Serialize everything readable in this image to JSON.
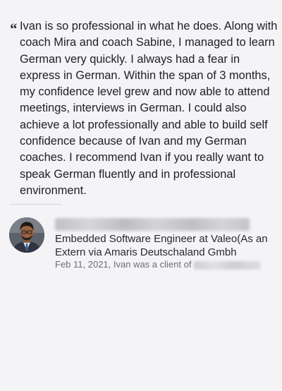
{
  "recommendation": {
    "quote_mark": "“",
    "text": "Ivan is so professional in what he does. Along with coach Mira and coach Sabine, I managed to learn German very quickly. I always had a fear in express in German. Within the span of 3 months, my confidence level grew and now able to attend meetings, interviews in German. I could also achieve a lot professionally and able to build self confidence because of Ivan and my German coaches. I recommend Ivan if you really want to speak German fluently and in professional environment."
  },
  "reviewer": {
    "name": "Sudharshana V Ramasubramanian",
    "headline": "Embedded Software Engineer at Valeo(As an Extern via Amaris Deutschaland Gmbh",
    "meta_prefix": "Feb 11, 2021, Ivan was a client of",
    "meta_name": "Sudharshana V"
  },
  "colors": {
    "background": "#f4f4f6",
    "text_primary": "#202124",
    "text_secondary": "#6e6e73"
  }
}
